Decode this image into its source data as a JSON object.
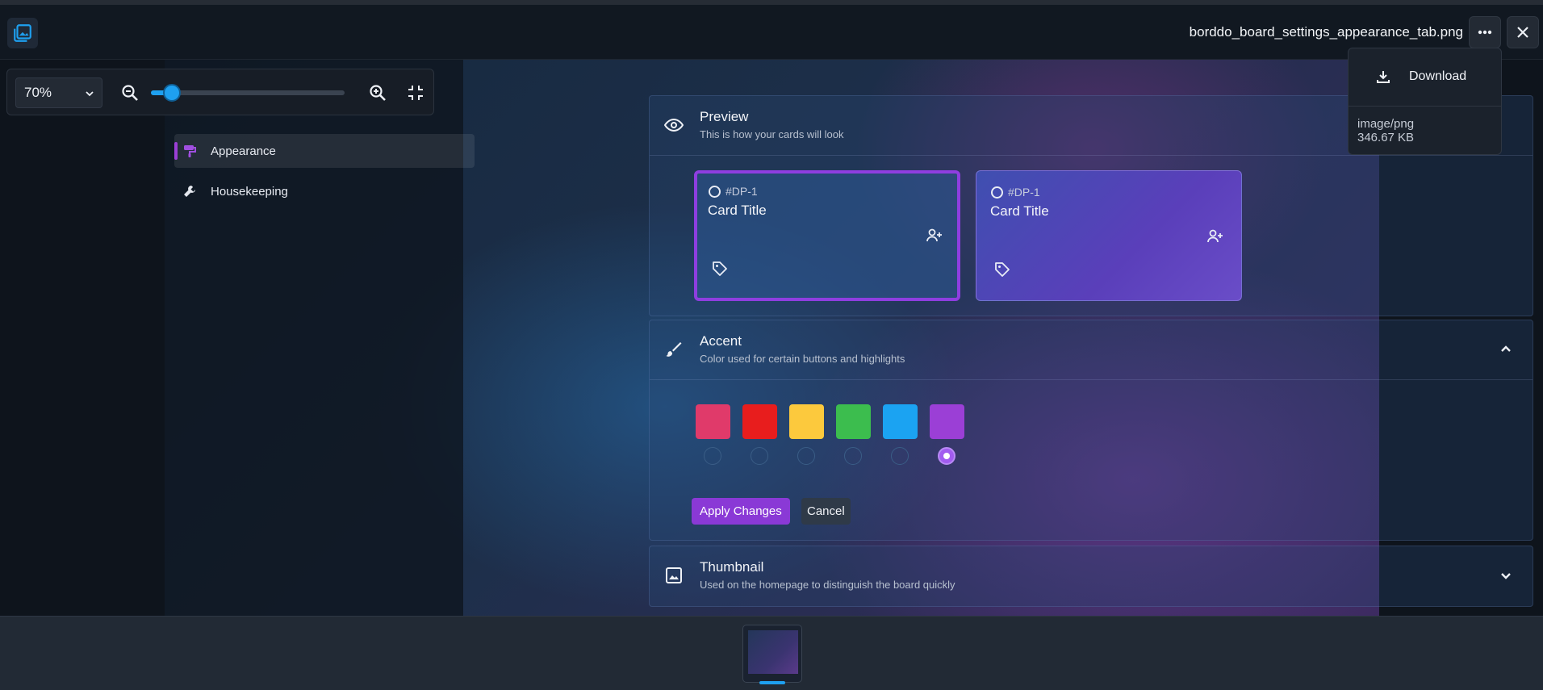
{
  "header": {
    "filename": "borddo_board_settings_appearance_tab.png"
  },
  "zoom": {
    "level": "70%",
    "slider_fraction": 0.11
  },
  "menu": {
    "download_label": "Download",
    "mime": "image/png",
    "size": "346.67 KB"
  },
  "screenshot": {
    "sidebar": {
      "items": [
        {
          "label": "Appearance",
          "active": true,
          "icon": "paint-roller-icon"
        },
        {
          "label": "Housekeeping",
          "active": false,
          "icon": "wrench-icon"
        }
      ]
    },
    "preview": {
      "title": "Preview",
      "subtitle": "This is how your cards will look",
      "cards": [
        {
          "id": "#DP-1",
          "title": "Card Title"
        },
        {
          "id": "#DP-1",
          "title": "Card Title"
        }
      ]
    },
    "accent": {
      "title": "Accent",
      "subtitle": "Color used for certain buttons and highlights",
      "colors": [
        "#e03a6a",
        "#e81d1d",
        "#fcc93d",
        "#3cbd4e",
        "#1ba3f2",
        "#9b3fd6"
      ],
      "selected_index": 5,
      "apply_label": "Apply Changes",
      "cancel_label": "Cancel"
    },
    "thumbnail": {
      "title": "Thumbnail",
      "subtitle": "Used on the homepage to distinguish the board quickly"
    }
  }
}
